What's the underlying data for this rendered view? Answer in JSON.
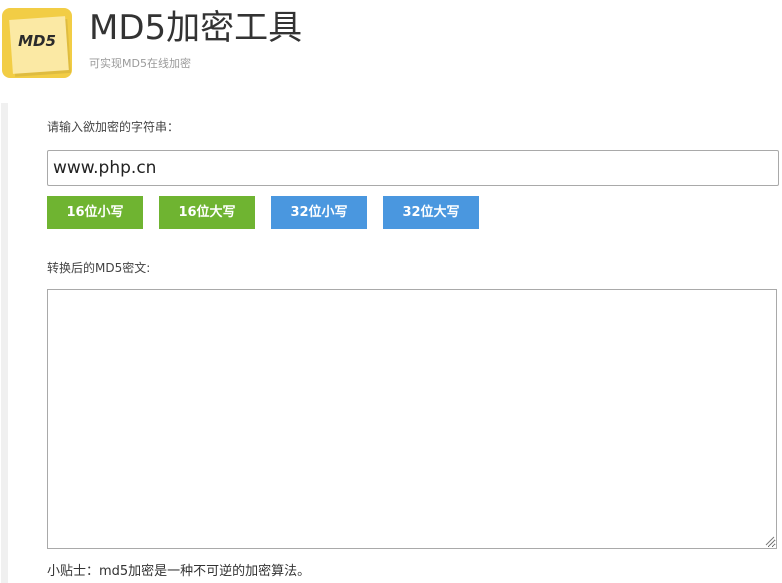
{
  "header": {
    "logo_text": "MD5",
    "title": "MD5加密工具",
    "subtitle": "可实现MD5在线加密"
  },
  "form": {
    "input_label": "请输入欲加密的字符串：",
    "input_value": "www.php.cn",
    "buttons": [
      {
        "label": "16位小写",
        "color": "#6fb431"
      },
      {
        "label": "16位大写",
        "color": "#6fb431"
      },
      {
        "label": "32位小写",
        "color": "#4a97df"
      },
      {
        "label": "32位大写",
        "color": "#4a97df"
      }
    ],
    "output_label": "转换后的MD5密文:",
    "output_value": ""
  },
  "tip": "小贴士：md5加密是一种不可逆的加密算法。"
}
